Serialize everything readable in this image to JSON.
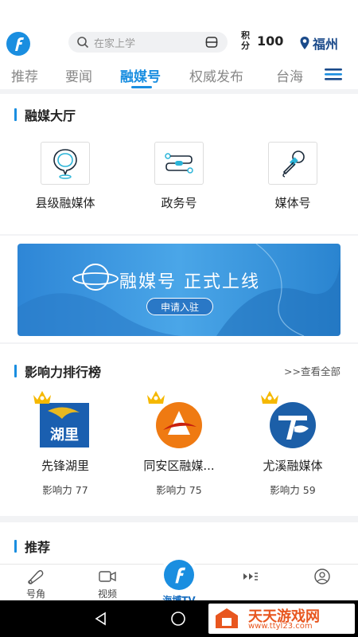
{
  "header": {
    "search_placeholder": "在家上学",
    "points_label": "积分",
    "points_value": "100",
    "location": "福州"
  },
  "tabs": [
    {
      "label": "推荐"
    },
    {
      "label": "要闻"
    },
    {
      "label": "融媒号",
      "active": true
    },
    {
      "label": "权威发布"
    },
    {
      "label": "台海"
    }
  ],
  "hall": {
    "title": "融媒大厅",
    "items": [
      {
        "label": "县级融媒体",
        "icon": "location-pin-icon"
      },
      {
        "label": "政务号",
        "icon": "connection-icon"
      },
      {
        "label": "媒体号",
        "icon": "microphone-icon"
      }
    ]
  },
  "banner": {
    "title": "融媒号 正式上线",
    "button": "申请入驻"
  },
  "ranking": {
    "title": "影响力排行榜",
    "view_all": ">>查看全部",
    "items": [
      {
        "name": "先锋湖里",
        "score": "影响力 77",
        "logo_text": "湖里"
      },
      {
        "name": "同安区融媒...",
        "score": "影响力 75"
      },
      {
        "name": "尤溪融媒体",
        "score": "影响力 59"
      }
    ]
  },
  "recommend": {
    "title": "推荐"
  },
  "bottom_nav": [
    {
      "label": "号角",
      "icon": "horn-icon"
    },
    {
      "label": "视频",
      "icon": "video-icon"
    },
    {
      "label": "海博TV",
      "icon": "haibo-logo-icon"
    },
    {
      "label": "",
      "icon": "live-icon"
    },
    {
      "label": "",
      "icon": "profile-icon"
    }
  ],
  "watermark": {
    "title": "天天游戏网",
    "url": "www.ttyl23.com"
  },
  "colors": {
    "accent": "#1a8ee0",
    "banner": "#3a96dc",
    "crown": "#f5b800",
    "orange": "#e8561f"
  }
}
